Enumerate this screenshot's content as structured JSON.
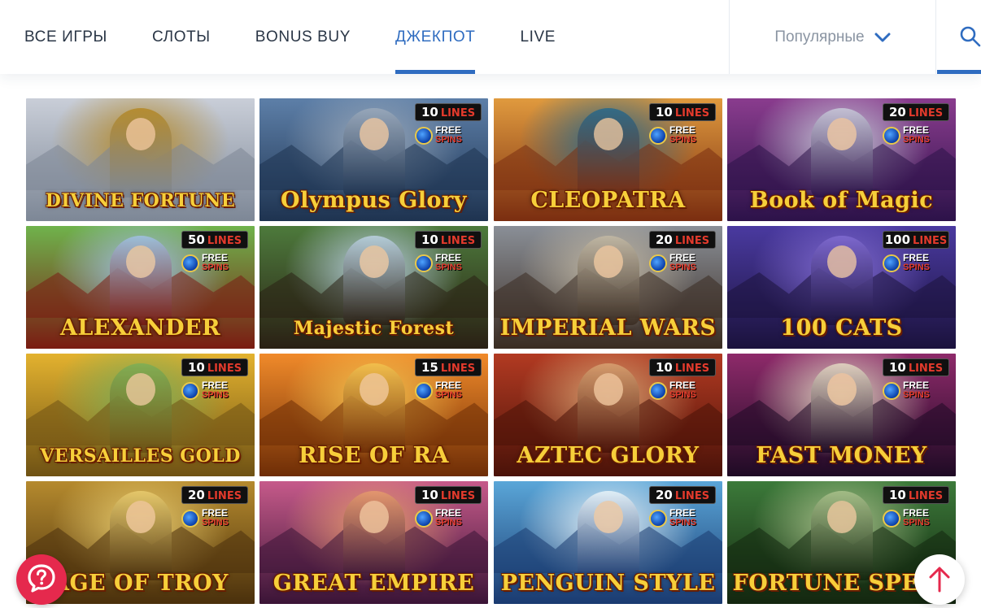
{
  "nav": {
    "tabs": [
      {
        "label": "ВСЕ ИГРЫ",
        "active": false
      },
      {
        "label": "СЛОТЫ",
        "active": false
      },
      {
        "label": "BONUS BUY",
        "active": false
      },
      {
        "label": "ДЖЕКПОТ",
        "active": true
      },
      {
        "label": "LIVE",
        "active": false
      }
    ],
    "sort_label": "Популярные",
    "sort_icon": "chevron-down-icon",
    "search_icon": "search-icon"
  },
  "colors": {
    "accent": "#2f6cc0",
    "nav_text": "#2a3646",
    "muted_text": "#8a94a2",
    "chat_button": "#e5294d"
  },
  "games": [
    {
      "title": "DIVINE FORTUNE",
      "lines": null,
      "colors": [
        "#c9ced8",
        "#7d8796",
        "#b58a2a"
      ]
    },
    {
      "title": "Olympus Glory",
      "lines": "10",
      "colors": [
        "#5d7fa8",
        "#1e3350",
        "#9aa9bb"
      ]
    },
    {
      "title": "CLEOPATRA",
      "lines": "10",
      "colors": [
        "#e09a3e",
        "#7a2d10",
        "#2b6a8a"
      ]
    },
    {
      "title": "Book of Magic",
      "lines": "20",
      "colors": [
        "#8a3c8e",
        "#2c1249",
        "#c7c7d8"
      ]
    },
    {
      "title": "ALEXANDER",
      "lines": "50",
      "colors": [
        "#6fb34c",
        "#7a1c12",
        "#9fc0e0"
      ]
    },
    {
      "title": "Majestic Forest",
      "lines": "10",
      "colors": [
        "#4d7a3c",
        "#2a2014",
        "#b9d0df"
      ]
    },
    {
      "title": "IMPERIAL WARS",
      "lines": "20",
      "colors": [
        "#8a8f97",
        "#3a2c22",
        "#c2b8a4"
      ]
    },
    {
      "title": "100 CATS",
      "lines": "100",
      "colors": [
        "#4a3aa0",
        "#1b123d",
        "#7f6ad0"
      ]
    },
    {
      "title": "VERSAILLES GOLD",
      "lines": "10",
      "colors": [
        "#e3b22f",
        "#6f5214",
        "#7fae56"
      ]
    },
    {
      "title": "RISE OF RA",
      "lines": "15",
      "colors": [
        "#f08a2a",
        "#6e2d06",
        "#f3c14f"
      ]
    },
    {
      "title": "AZTEC GLORY",
      "lines": "10",
      "colors": [
        "#b23a22",
        "#4a1208",
        "#d7a070"
      ]
    },
    {
      "title": "FAST MONEY",
      "lines": "10",
      "colors": [
        "#8e2a6a",
        "#1e0a24",
        "#e2d6c2"
      ]
    },
    {
      "title": "AGE OF TROY",
      "lines": "20",
      "colors": [
        "#b58a2e",
        "#4a300c",
        "#e8cb6e"
      ]
    },
    {
      "title": "GREAT EMPIRE",
      "lines": "10",
      "colors": [
        "#c65a8a",
        "#3a1436",
        "#e59a6e"
      ]
    },
    {
      "title": "PENGUIN STYLE",
      "lines": "20",
      "colors": [
        "#5aa6d8",
        "#1a3a70",
        "#e7f2f8"
      ]
    },
    {
      "title": "FORTUNE SPELL",
      "lines": "10",
      "colors": [
        "#3c7a3a",
        "#13260f",
        "#a8c08a"
      ]
    }
  ],
  "badge": {
    "lines_word": "LINES",
    "free_word": "FREE",
    "spins_word": "SPINS"
  },
  "floating": {
    "chat_icon": "chat-question-icon",
    "scroll_top_icon": "arrow-up-icon"
  }
}
